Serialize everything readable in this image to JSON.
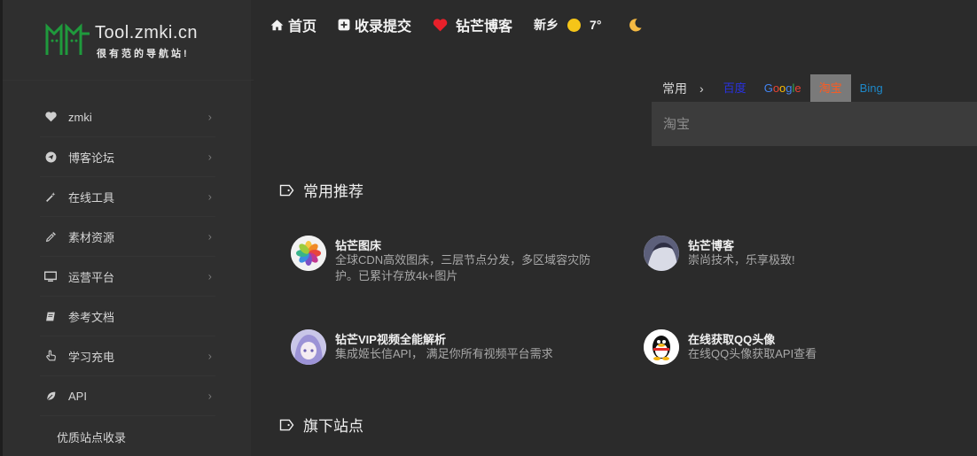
{
  "logo": {
    "title": "Tool.zmki.cn",
    "subtitle": "很有范的导航站!"
  },
  "sidebar": {
    "items": [
      {
        "label": "zmki",
        "icon": "heart-icon"
      },
      {
        "label": "博客论坛",
        "icon": "telegram-icon"
      },
      {
        "label": "在线工具",
        "icon": "magic-wand-icon"
      },
      {
        "label": "素材资源",
        "icon": "eyedropper-icon"
      },
      {
        "label": "运营平台",
        "icon": "monitor-icon"
      },
      {
        "label": "参考文档",
        "icon": "book-icon"
      },
      {
        "label": "学习充电",
        "icon": "hand-pointer-icon"
      },
      {
        "label": "API",
        "icon": "leaf-icon"
      }
    ],
    "footer_label": "优质站点收录"
  },
  "topbar": {
    "home": "首页",
    "submit": "收录提交",
    "blog": "钻芒博客",
    "weather_city": "新乡",
    "weather_temp": "7°"
  },
  "search": {
    "group": "常用",
    "tabs": [
      "百度",
      "Google",
      "淘宝",
      "Bing"
    ],
    "active_tab": "淘宝",
    "placeholder": "淘宝"
  },
  "sections": {
    "recommended": "常用推荐",
    "our_sites": "旗下站点"
  },
  "cards": [
    {
      "title": "钻芒图床",
      "desc": "全球CDN高效图床，三层节点分发，多区域容灾防护。已累计存放4k+图片",
      "icon": "photos-app-icon"
    },
    {
      "title": "钻芒博客",
      "desc": "崇尚技术，乐享极致!",
      "icon": "anime-avatar-icon"
    },
    {
      "title": "钻芒VIP视频全能解析",
      "desc": "集成姬长信API， 满足你所有视频平台需求",
      "icon": "anime-girl-avatar-icon"
    },
    {
      "title": "在线获取QQ头像",
      "desc": "在线QQ头像获取API查看",
      "icon": "qq-penguin-icon"
    }
  ],
  "colors": {
    "background": "#2b2b2b",
    "sidebar": "#2f2f2f",
    "accent_active_tab": "#ff5a1f",
    "baidu": "#2932e1",
    "bing": "#1e88c8",
    "sun": "#f5c518",
    "moon": "#f5b942",
    "heart_red": "#e8202a",
    "logo_green": "#1f9a3c"
  }
}
